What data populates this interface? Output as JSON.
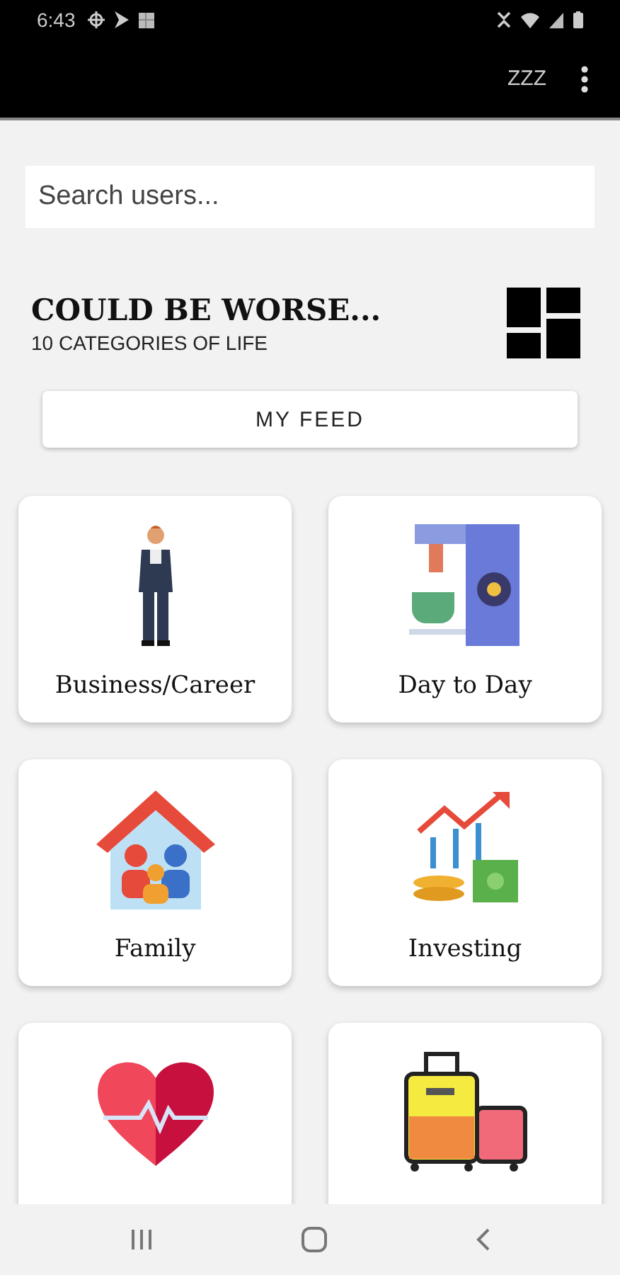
{
  "status_bar": {
    "time": "6:43"
  },
  "app_bar": {
    "action": "ZZZ"
  },
  "search": {
    "placeholder": "Search users..."
  },
  "header": {
    "title": "COULD BE WORSE...",
    "subtitle": "10 CATEGORIES OF LIFE"
  },
  "feed_button": {
    "label": "MY FEED"
  },
  "categories": [
    {
      "kind": "business",
      "label": "Business/Career"
    },
    {
      "kind": "daily",
      "label": "Day to Day"
    },
    {
      "kind": "family",
      "label": "Family"
    },
    {
      "kind": "investing",
      "label": "Investing"
    },
    {
      "kind": "health"
    },
    {
      "kind": "travel"
    }
  ]
}
